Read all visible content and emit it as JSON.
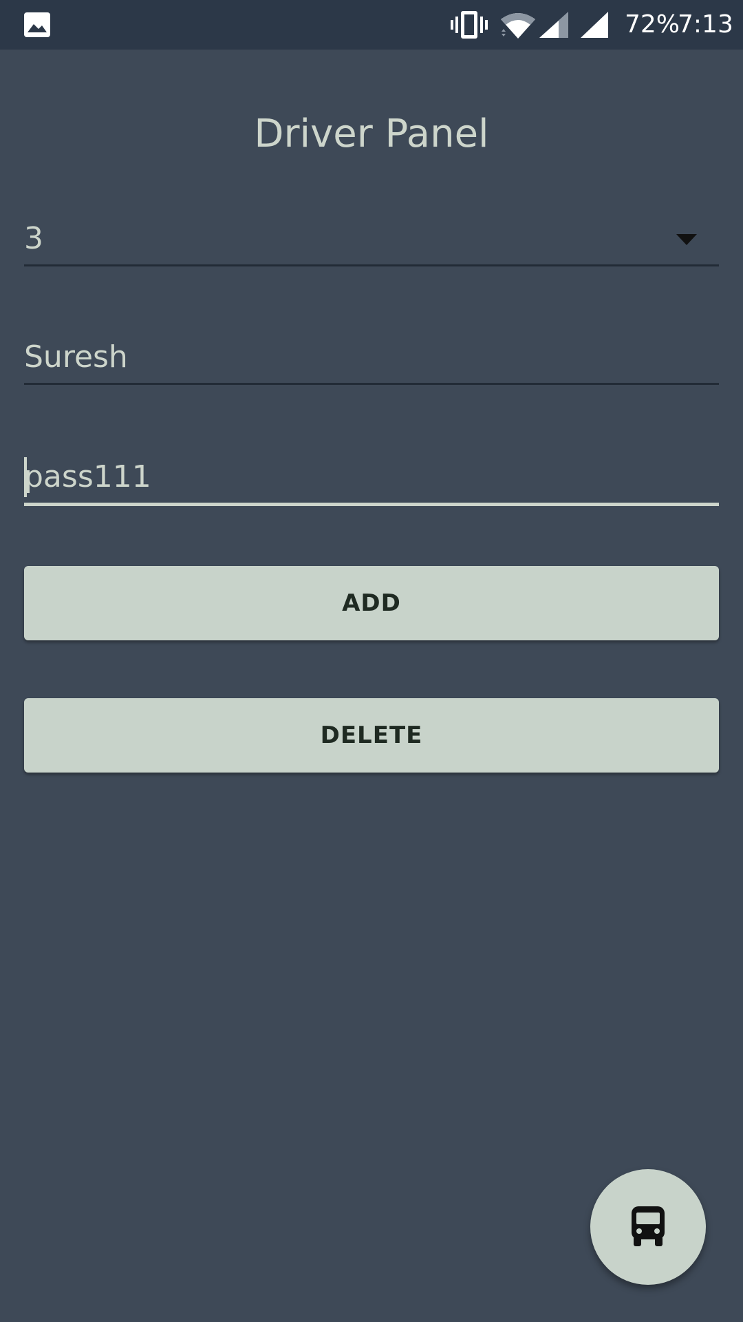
{
  "status_bar": {
    "battery": "72%",
    "time": "7:13",
    "icons": [
      "gallery-icon",
      "vibrate-icon",
      "wifi-icon",
      "signal-icon",
      "signal-icon"
    ]
  },
  "page": {
    "title": "Driver Panel"
  },
  "form": {
    "spinner_value": "3",
    "username_value": "Suresh",
    "password_value": "pass111"
  },
  "buttons": {
    "add_label": "ADD",
    "delete_label": "DELETE"
  },
  "fab": {
    "icon": "bus-icon"
  },
  "colors": {
    "background": "#3e4957",
    "status_bar": "#2c3848",
    "text": "#cdd5cb",
    "button": "#c8d3ca"
  }
}
